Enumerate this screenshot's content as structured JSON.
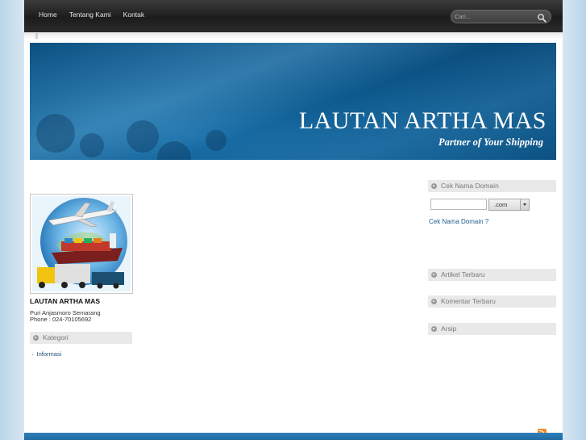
{
  "nav": {
    "items": [
      {
        "label": "Home"
      },
      {
        "label": "Tentang Kami"
      },
      {
        "label": "Kontak"
      }
    ]
  },
  "search": {
    "placeholder": "Cari..."
  },
  "banner": {
    "title": "LAUTAN ARTHA MAS",
    "subtitle": "Partner of  Your  Shipping"
  },
  "profile": {
    "name": "LAUTAN ARTHA MAS",
    "address_line1": "Puri Anjasmoro Semarang",
    "address_line2": "Phone : 024-70105692"
  },
  "left_sidebar": {
    "category_heading": "Kategori",
    "categories": [
      {
        "label": "Informasi"
      }
    ]
  },
  "right_sidebar": {
    "domain_heading": "Cek Nama Domain",
    "domain_input_value": "",
    "domain_select_value": ".com",
    "domain_link": "Cek Nama Domain ?",
    "articles_heading": "Artikel Terbaru",
    "comments_heading": "Komentar Terbaru",
    "archive_heading": "Arsip"
  },
  "colors": {
    "banner_blue": "#0d5a8e",
    "link_blue": "#1f5f8f",
    "topbar_dark": "#1c1c1c",
    "footer_blue": "#1f6aa3",
    "rss_orange": "#f08a24"
  },
  "icons": {
    "search": "magnifier-icon",
    "rss": "rss-feed-icon",
    "bullet": "circle-arrow-icon"
  }
}
